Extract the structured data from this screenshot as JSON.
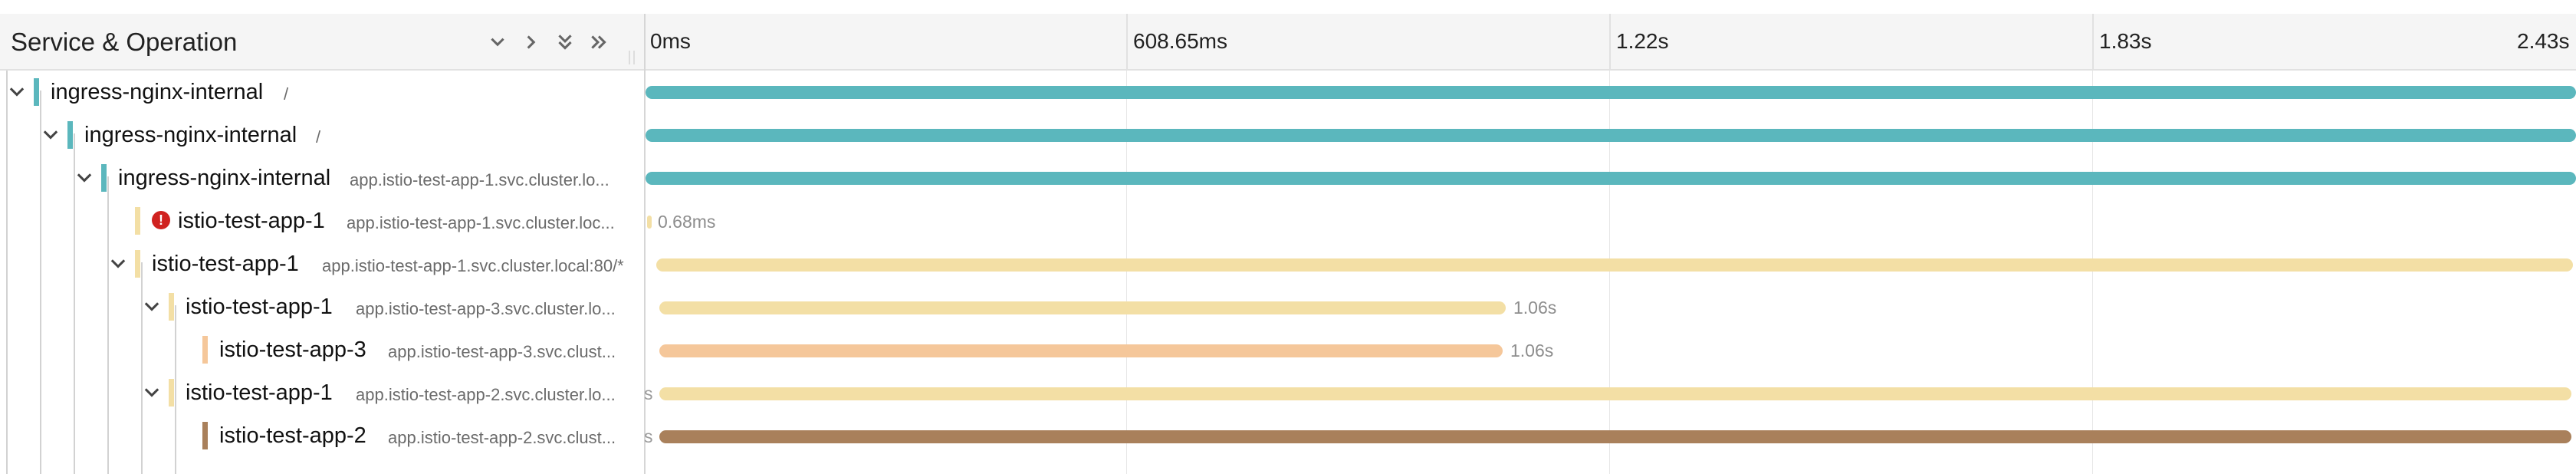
{
  "header": {
    "title": "Service & Operation",
    "ticks": [
      "0ms",
      "608.65ms",
      "1.22s",
      "1.83s",
      "2.43s"
    ]
  },
  "colors": {
    "teal": "#5bb7bd",
    "light_yellow": "#f3dfa5",
    "peach": "#f5c79a",
    "brown": "#a9805b",
    "error": "#d0221f"
  },
  "rows": [
    {
      "service": "ingress-nginx-internal",
      "operation": "/"
    },
    {
      "service": "ingress-nginx-internal",
      "operation": "/"
    },
    {
      "service": "ingress-nginx-internal",
      "operation": "app.istio-test-app-1.svc.cluster.lo..."
    },
    {
      "service": "istio-test-app-1",
      "operation": "app.istio-test-app-1.svc.cluster.loc...",
      "duration": "0.68ms"
    },
    {
      "service": "istio-test-app-1",
      "operation": "app.istio-test-app-1.svc.cluster.local:80/*"
    },
    {
      "service": "istio-test-app-1",
      "operation": "app.istio-test-app-3.svc.cluster.lo...",
      "duration": "1.06s"
    },
    {
      "service": "istio-test-app-3",
      "operation": "app.istio-test-app-3.svc.clust...",
      "duration": "1.06s"
    },
    {
      "service": "istio-test-app-1",
      "operation": "app.istio-test-app-2.svc.cluster.lo..."
    },
    {
      "service": "istio-test-app-2",
      "operation": "app.istio-test-app-2.svc.clust..."
    }
  ],
  "overflow_marker": "s"
}
